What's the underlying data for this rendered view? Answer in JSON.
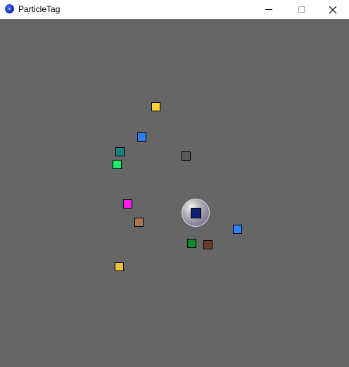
{
  "window": {
    "title": "ParticleTag",
    "controls": {
      "minimize": "minimize-icon",
      "maximize": "maximize-icon",
      "close": "close-icon"
    }
  },
  "canvas": {
    "background": "#666666",
    "particles": [
      {
        "color": "#ffd23a"
      },
      {
        "color": "#2f7bff"
      },
      {
        "color": "#128377"
      },
      {
        "color": "#19f06a"
      },
      {
        "color": "#5a5a5a"
      },
      {
        "color": "#ff1cf0"
      },
      {
        "color": "#a47552"
      },
      {
        "color": "#2a84ff"
      },
      {
        "color": "#138a2a"
      },
      {
        "color": "#6a3a28"
      },
      {
        "color": "#e8c23c"
      }
    ],
    "player": {
      "core_color": "#0f1f6e"
    }
  }
}
